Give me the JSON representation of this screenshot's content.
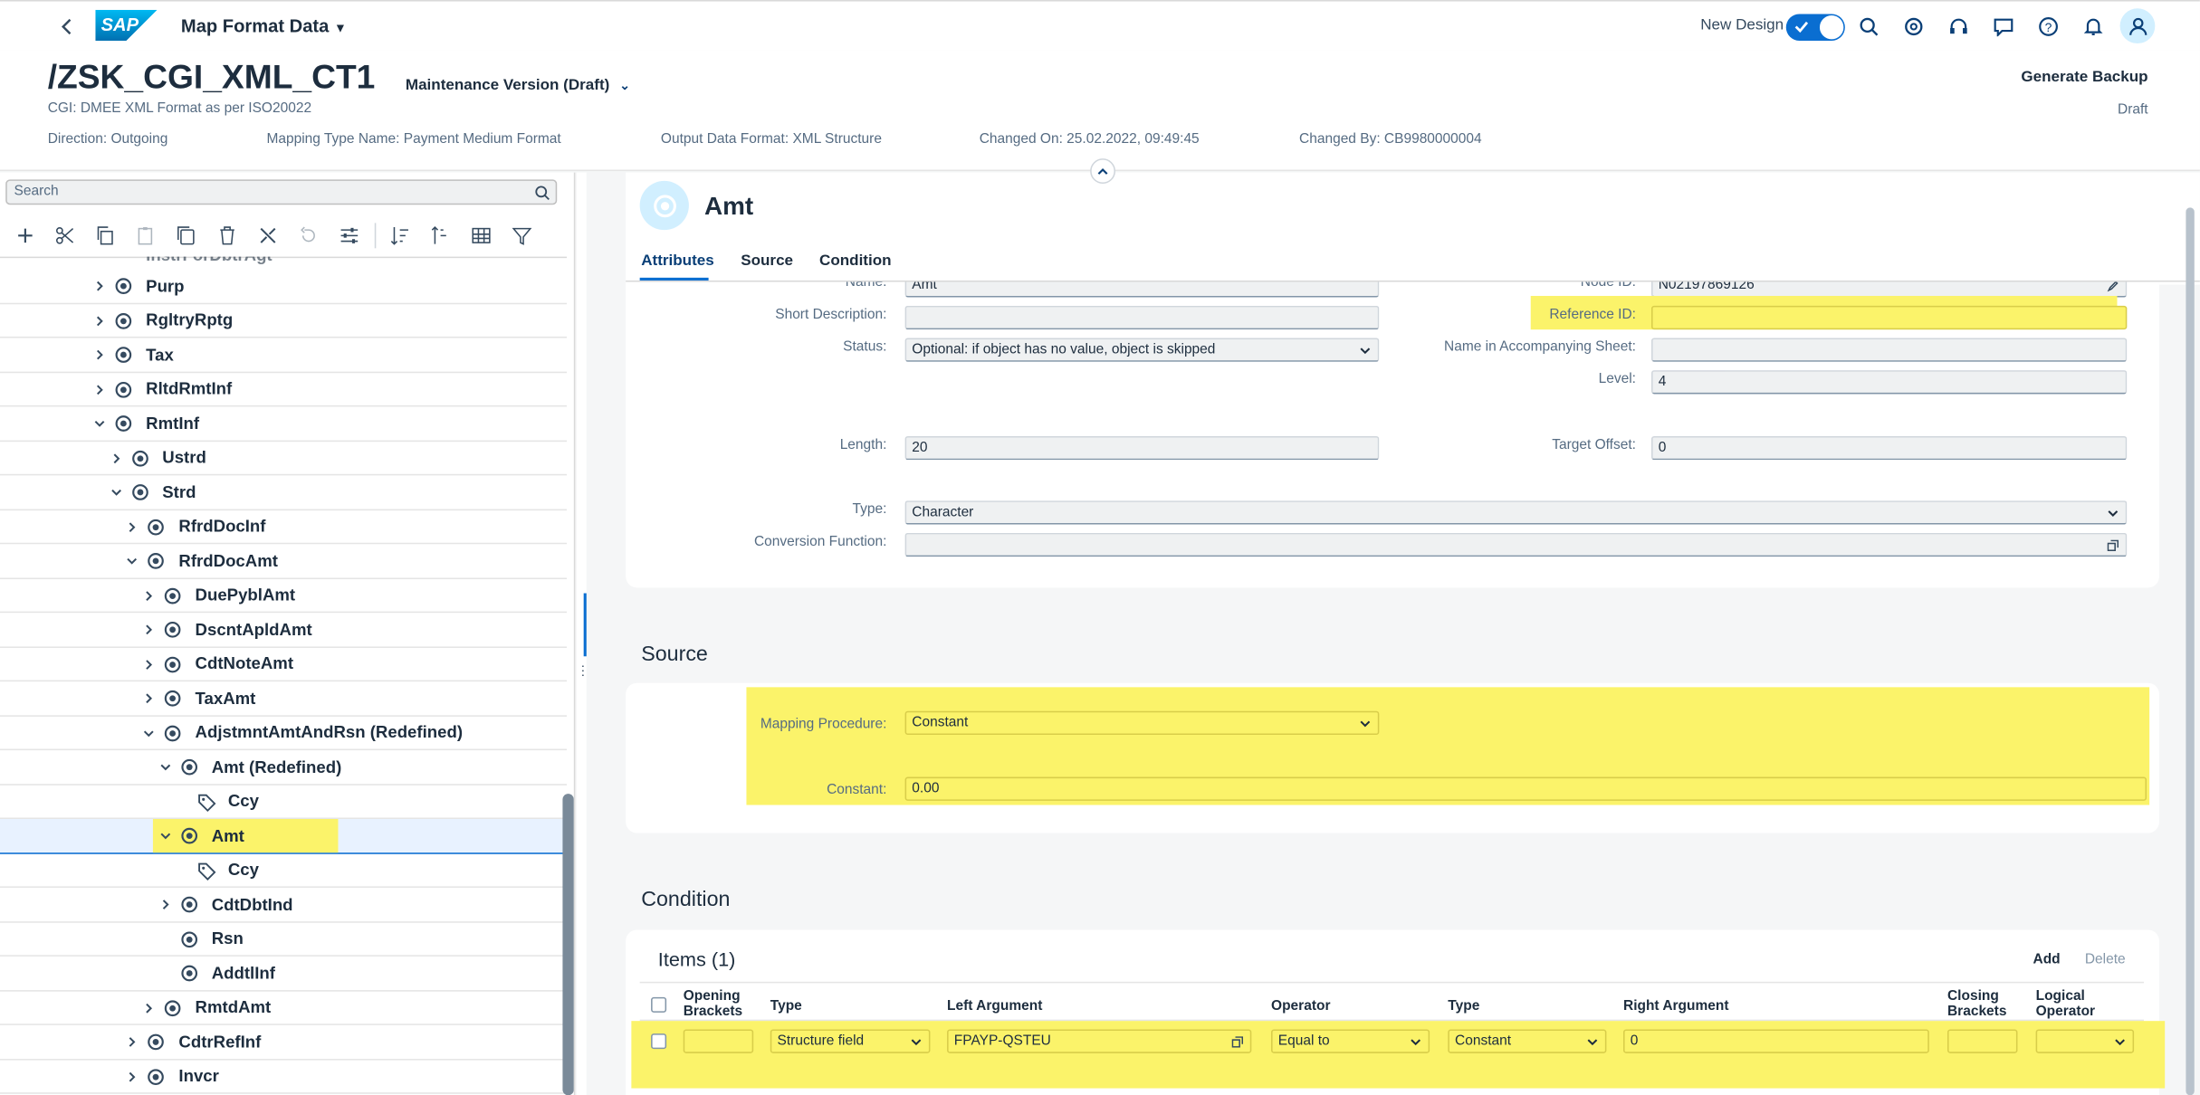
{
  "shell": {
    "app_title": "Map Format Data",
    "new_design_label": "New Design",
    "logo_text": "SAP"
  },
  "header": {
    "title": "/ZSK_CGI_XML_CT1",
    "version": "Maintenance Version (Draft)",
    "subtitle": "CGI: DMEE XML Format as per ISO20022",
    "generate_backup": "Generate Backup",
    "status": "Draft",
    "attrs": [
      "Direction: Outgoing",
      "Mapping Type Name: Payment Medium Format",
      "Output Data Format: XML Structure",
      "Changed On: 25.02.2022, 09:49:45",
      "Changed By: CB9980000004"
    ]
  },
  "tree": {
    "search_placeholder": "Search",
    "rows": [
      {
        "label": "Purp",
        "level": 0,
        "chev": "right",
        "icon": "node"
      },
      {
        "label": "RgltryRptg",
        "level": 0,
        "chev": "right",
        "icon": "node"
      },
      {
        "label": "Tax",
        "level": 0,
        "chev": "right",
        "icon": "node"
      },
      {
        "label": "RltdRmtInf",
        "level": 0,
        "chev": "right",
        "icon": "node"
      },
      {
        "label": "RmtInf",
        "level": 0,
        "chev": "down",
        "icon": "node"
      },
      {
        "label": "Ustrd",
        "level": 1,
        "chev": "right",
        "icon": "node"
      },
      {
        "label": "Strd",
        "level": 1,
        "chev": "down",
        "icon": "node"
      },
      {
        "label": "RfrdDocInf",
        "level": 2,
        "chev": "right",
        "icon": "node"
      },
      {
        "label": "RfrdDocAmt",
        "level": 2,
        "chev": "down",
        "icon": "node"
      },
      {
        "label": "DuePyblAmt",
        "level": 3,
        "chev": "right",
        "icon": "node"
      },
      {
        "label": "DscntApldAmt",
        "level": 3,
        "chev": "right",
        "icon": "node"
      },
      {
        "label": "CdtNoteAmt",
        "level": 3,
        "chev": "right",
        "icon": "node"
      },
      {
        "label": "TaxAmt",
        "level": 3,
        "chev": "right",
        "icon": "node"
      },
      {
        "label": "AdjstmntAmtAndRsn (Redefined)",
        "level": 3,
        "chev": "down",
        "icon": "node"
      },
      {
        "label": "Amt (Redefined)",
        "level": 4,
        "chev": "down",
        "icon": "node"
      },
      {
        "label": "Ccy",
        "level": 5,
        "chev": "",
        "icon": "tag"
      },
      {
        "label": "Amt",
        "level": 4,
        "chev": "down",
        "icon": "node",
        "selected": true
      },
      {
        "label": "Ccy",
        "level": 5,
        "chev": "",
        "icon": "tag"
      },
      {
        "label": "CdtDbtInd",
        "level": 4,
        "chev": "right",
        "icon": "node"
      },
      {
        "label": "Rsn",
        "level": 4,
        "chev": "",
        "icon": "node"
      },
      {
        "label": "AddtlInf",
        "level": 4,
        "chev": "",
        "icon": "node"
      },
      {
        "label": "RmtdAmt",
        "level": 3,
        "chev": "right",
        "icon": "node"
      },
      {
        "label": "CdtrRefInf",
        "level": 2,
        "chev": "right",
        "icon": "node"
      },
      {
        "label": "Invcr",
        "level": 2,
        "chev": "right",
        "icon": "node"
      }
    ]
  },
  "detail": {
    "title": "Amt",
    "tabs": [
      "Attributes",
      "Source",
      "Condition"
    ],
    "attributes": {
      "name_label": "Name:",
      "name_value": "Amt",
      "short_desc_label": "Short Description:",
      "short_desc_value": "",
      "status_label": "Status:",
      "status_value": "Optional: if object has no value, object is skipped",
      "node_id_label": "Node ID:",
      "node_id_value": "N02197869126",
      "reference_id_label": "Reference ID:",
      "reference_id_value": "",
      "accompanying_label": "Name in Accompanying Sheet:",
      "accompanying_value": "",
      "level_label": "Level:",
      "level_value": "4",
      "length_label": "Length:",
      "length_value": "20",
      "target_offset_label": "Target Offset:",
      "target_offset_value": "0",
      "type_label": "Type:",
      "type_value": "Character",
      "conversion_label": "Conversion Function:",
      "conversion_value": ""
    },
    "source": {
      "title": "Source",
      "mapping_label": "Mapping Procedure:",
      "mapping_value": "Constant",
      "constant_label": "Constant:",
      "constant_value": "0.00"
    },
    "condition": {
      "title": "Condition",
      "items_title": "Items (1)",
      "add": "Add",
      "delete": "Delete",
      "columns": [
        "Opening Brackets",
        "Type",
        "Left Argument",
        "Operator",
        "Type",
        "Right Argument",
        "Closing Brackets",
        "Logical Operator"
      ],
      "row": {
        "opening": "",
        "type1": "Structure field",
        "left": "FPAYP-QSTEU",
        "operator": "Equal to",
        "type2": "Constant",
        "right": "0",
        "closing": "",
        "logical": ""
      }
    }
  },
  "colors": {
    "accent": "#0a6ed1",
    "highlight": "#fbf36a",
    "selected_row": "#e8f2ff"
  }
}
